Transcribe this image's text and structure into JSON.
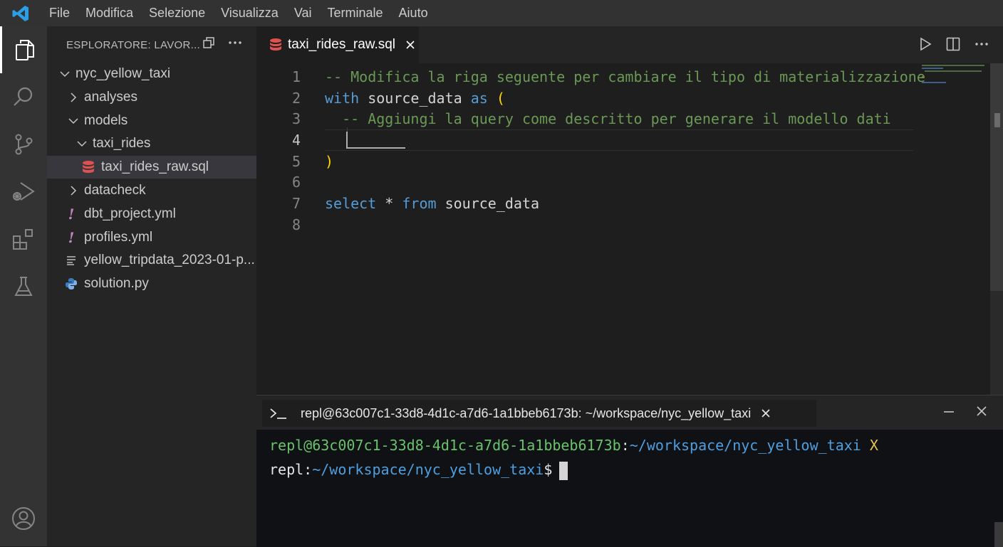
{
  "menubar": {
    "items": [
      "File",
      "Modifica",
      "Selezione",
      "Visualizza",
      "Vai",
      "Terminale",
      "Aiuto"
    ]
  },
  "activity_bar": {
    "icons": [
      "files-icon",
      "search-icon",
      "source-control-icon",
      "run-debug-icon",
      "extensions-icon",
      "testing-icon",
      "account-icon"
    ]
  },
  "sidebar": {
    "title": "ESPLORATORE: LAVOR...",
    "tree": [
      {
        "label": "nyc_yellow_taxi",
        "kind": "folder",
        "expanded": true,
        "depth": 0
      },
      {
        "label": "analyses",
        "kind": "folder",
        "expanded": false,
        "depth": 1
      },
      {
        "label": "models",
        "kind": "folder",
        "expanded": true,
        "depth": 1
      },
      {
        "label": "taxi_rides",
        "kind": "folder",
        "expanded": true,
        "depth": 2
      },
      {
        "label": "taxi_rides_raw.sql",
        "kind": "sql",
        "depth": 3,
        "selected": true
      },
      {
        "label": "datacheck",
        "kind": "folder",
        "expanded": false,
        "depth": 1
      },
      {
        "label": "dbt_project.yml",
        "kind": "yml",
        "depth": 1
      },
      {
        "label": "profiles.yml",
        "kind": "yml",
        "depth": 1
      },
      {
        "label": "yellow_tripdata_2023-01-p...",
        "kind": "text",
        "depth": 1
      },
      {
        "label": "solution.py",
        "kind": "python",
        "depth": 1
      }
    ]
  },
  "editor": {
    "tab_label": "taxi_rides_raw.sql",
    "line_numbers": [
      "1",
      "2",
      "3",
      "4",
      "5",
      "6",
      "7",
      "8"
    ],
    "current_line": 4,
    "lines": {
      "l1_comment": "-- Modifica la riga seguente per cambiare il tipo di materializzazione",
      "l2_with": "with",
      "l2_name": " source_data ",
      "l2_as": "as",
      "l2_paren": " (",
      "l3_indent": "  ",
      "l3_comment": "-- Aggiungi la query come descritto per generare il modello dati",
      "l5_paren": ")",
      "l7_select": "select",
      "l7_star": " * ",
      "l7_from": "from",
      "l7_name": " source_data"
    }
  },
  "terminal": {
    "tab_label": "repl@63c007c1-33d8-4d1c-a7d6-1a1bbeb6173b: ~/workspace/nyc_yellow_taxi",
    "line1_user": "repl@63c007c1-33d8-4d1c-a7d6-1a1bbeb6173b",
    "line1_colon": ":",
    "line1_path": "~/workspace/nyc_yellow_taxi",
    "line1_x": " X",
    "line2_user": "repl:",
    "line2_path": "~/workspace/nyc_yellow_taxi",
    "line2_prompt": "$"
  },
  "colors": {
    "accent": "#007acc",
    "sql_icon": "#e05252",
    "comment": "#6a9955",
    "keyword": "#569cd6"
  }
}
